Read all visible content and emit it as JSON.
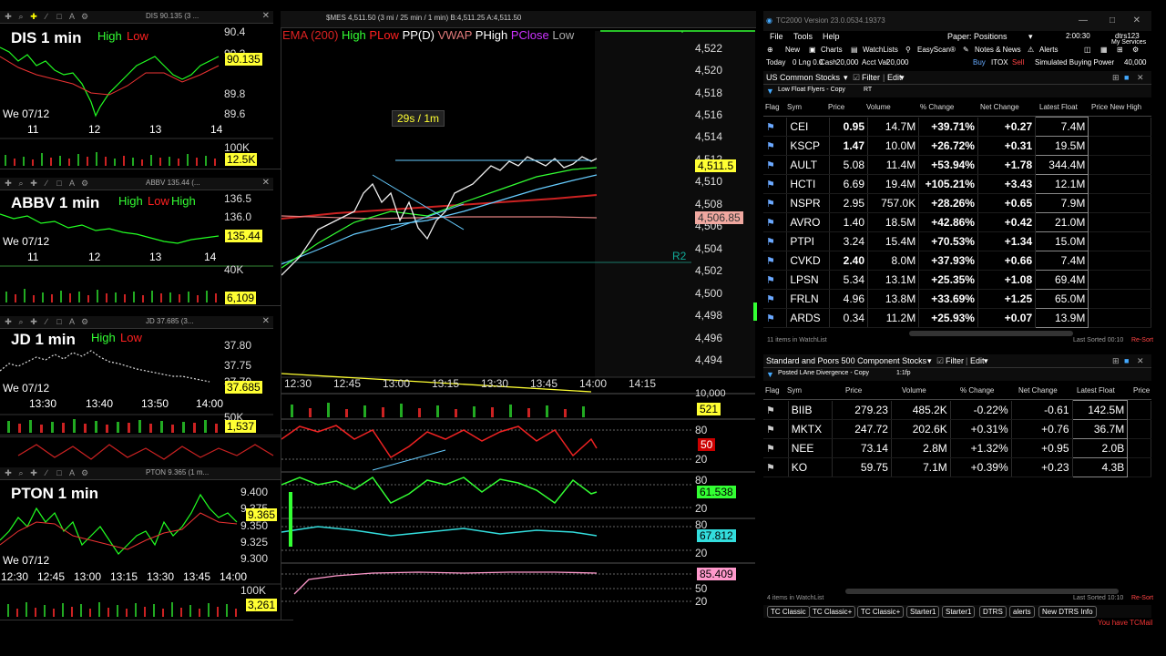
{
  "mini_charts": [
    {
      "caption": "DIS 90.135 (3 ...",
      "title": "DIS 1 min",
      "legend": [
        "High",
        "Low"
      ],
      "date": "We 07/12",
      "y_ticks": [
        "90.4",
        "90.2",
        "89.8",
        "89.6"
      ],
      "x_ticks": [
        "11",
        "12",
        "13",
        "14"
      ],
      "price_tag": "90.135",
      "volume_tick": "100K",
      "volume_tag": "12.5K"
    },
    {
      "caption": "ABBV 135.44 (...",
      "title": "ABBV 1 min",
      "legend": [
        "High",
        "Low",
        "High"
      ],
      "date": "We 07/12",
      "y_ticks": [
        "136.5",
        "136.0",
        "40K"
      ],
      "x_ticks": [
        "11",
        "12",
        "13",
        "14"
      ],
      "price_tag": "135.44",
      "volume_tick": "",
      "volume_tag": "6,109"
    },
    {
      "caption": "JD 37.685 (3...",
      "title": "JD 1 min",
      "legend": [
        "High",
        "Low"
      ],
      "date": "We 07/12",
      "y_ticks": [
        "37.80",
        "37.75",
        "37.70"
      ],
      "x_ticks": [
        "13:30",
        "13:40",
        "13:50",
        "14:00"
      ],
      "price_tag": "37.685",
      "volume_tick": "50K",
      "volume_tag": "1,537"
    },
    {
      "caption": "PTON 9.365 (1 m...",
      "title": "PTON 1 min",
      "legend": [],
      "date": "We 07/12",
      "y_ticks": [
        "9.400",
        "9.375",
        "9.350",
        "9.325",
        "9.300"
      ],
      "x_ticks": [
        "12:30",
        "12:45",
        "13:00",
        "13:15",
        "13:30",
        "13:45",
        "14:00"
      ],
      "price_tag": "9.365",
      "volume_tick": "100K",
      "volume_tag": "3,261"
    }
  ],
  "main_chart": {
    "caption": "$MES 4,511.50 (3 mi / 25 min / 1 min) B:4,511.25 A:4,511.50",
    "legend": [
      {
        "text": "EMA (200)",
        "color": "#d22"
      },
      {
        "text": "High",
        "color": "#33ff33"
      },
      {
        "text": "PLow",
        "color": "#ff2020"
      },
      {
        "text": "PP(D)",
        "color": "#ffffff"
      },
      {
        "text": "VWAP",
        "color": "#e07a7a"
      },
      {
        "text": "PHigh",
        "color": "#ffffff"
      },
      {
        "text": "PClose",
        "color": "#cc33ff"
      },
      {
        "text": "Low",
        "color": "#aaaaaa"
      }
    ],
    "interval_label": "29s / 1m",
    "pivot_label": "R2",
    "y_ticks": [
      "4,522",
      "4,520",
      "4,518",
      "4,516",
      "4,514",
      "4,512",
      "4,510",
      "4,508",
      "4,506",
      "4,504",
      "4,502",
      "4,500",
      "4,498",
      "4,496",
      "4,494"
    ],
    "x_ticks": [
      "12:30",
      "12:45",
      "13:00",
      "13:15",
      "13:30",
      "13:45",
      "14:00",
      "14:15"
    ],
    "price_tag": "4,511.5",
    "vwap_tag": "4,506.85",
    "volume_tick": "10,000",
    "volume_tag": "521",
    "stoch_tag": "50",
    "stoch_ticks": [
      "80",
      "20"
    ],
    "ind2_tag": "61.538",
    "ind2_ticks": [
      "80",
      "20"
    ],
    "ind3_tag": "67.812",
    "ind3_ticks": [
      "80",
      "20"
    ],
    "ind4_tag": "85.409",
    "ind4_ticks": [
      "80",
      "50",
      "20"
    ]
  },
  "right_panel": {
    "window_title": "TC2000 Version 23.0.0534.19373",
    "clock": "2:00:30",
    "user": "dtrs123",
    "user_sub": "My Services",
    "menu": [
      "File",
      "Tools",
      "Help"
    ],
    "layout_name": "Paper: Positions",
    "toolbar": [
      "New",
      "Charts",
      "WatchLists",
      "EasyScan®",
      "Notes & News",
      "Alerts"
    ],
    "account": {
      "today": "Today",
      "lng": "0 Lng 0.0",
      "cash_label": "Cash",
      "cash": "20,000",
      "acct_label": "Acct Val",
      "acct_val": "20,000",
      "buy": "Buy",
      "sym": "ITOX",
      "sell": "Sell",
      "buying_power_label": "Simulated Buying Power",
      "buying_power": "40,000"
    },
    "watchlist1": {
      "name": "US Common Stocks",
      "filter": "Filter",
      "edit": "Edit",
      "sub": "Low Float Flyers - Copy",
      "sub2": "RT",
      "columns": [
        "Flag",
        "Sym",
        "Price",
        "Volume",
        "% Change",
        "Net Change",
        "Latest Float",
        "Price New High"
      ],
      "rows": [
        {
          "sym": "CEI",
          "price": "0.95",
          "volume": "14.7M",
          "pct": "+39.71%",
          "net": "+0.27",
          "float": "7.4M",
          "bold": true
        },
        {
          "sym": "KSCP",
          "price": "1.47",
          "volume": "10.0M",
          "pct": "+26.72%",
          "net": "+0.31",
          "float": "19.5M",
          "bold": true
        },
        {
          "sym": "AULT",
          "price": "5.08",
          "volume": "11.4M",
          "pct": "+53.94%",
          "net": "+1.78",
          "float": "344.4M",
          "bold": false
        },
        {
          "sym": "HCTI",
          "price": "6.69",
          "volume": "19.4M",
          "pct": "+105.21%",
          "net": "+3.43",
          "float": "12.1M",
          "bold": false
        },
        {
          "sym": "NSPR",
          "price": "2.95",
          "volume": "757.0K",
          "pct": "+28.26%",
          "net": "+0.65",
          "float": "7.9M",
          "bold": false
        },
        {
          "sym": "AVRO",
          "price": "1.40",
          "volume": "18.5M",
          "pct": "+42.86%",
          "net": "+0.42",
          "float": "21.0M",
          "bold": false
        },
        {
          "sym": "PTPI",
          "price": "3.24",
          "volume": "15.4M",
          "pct": "+70.53%",
          "net": "+1.34",
          "float": "15.0M",
          "bold": false
        },
        {
          "sym": "CVKD",
          "price": "2.40",
          "volume": "8.0M",
          "pct": "+37.93%",
          "net": "+0.66",
          "float": "7.4M",
          "bold": true
        },
        {
          "sym": "LPSN",
          "price": "5.34",
          "volume": "13.1M",
          "pct": "+25.35%",
          "net": "+1.08",
          "float": "69.4M",
          "bold": false
        },
        {
          "sym": "FRLN",
          "price": "4.96",
          "volume": "13.8M",
          "pct": "+33.69%",
          "net": "+1.25",
          "float": "65.0M",
          "bold": false
        },
        {
          "sym": "ARDS",
          "price": "0.34",
          "volume": "11.2M",
          "pct": "+25.93%",
          "net": "+0.07",
          "float": "13.9M",
          "bold": false
        }
      ],
      "footer_count": "11 items in WatchList",
      "footer_sorted": "Last Sorted 00:10",
      "footer_resort": "Re-Sort"
    },
    "watchlist2": {
      "name": "Standard and Poors 500 Component Stocks",
      "filter": "Filter",
      "edit": "Edit",
      "sub": "Posted LAne Divergence - Copy",
      "sub2": "1:1fp",
      "columns": [
        "Flag",
        "Sym",
        "Price",
        "Volume",
        "% Change",
        "Net Change",
        "Latest Float",
        "Price"
      ],
      "rows": [
        {
          "sym": "BIIB",
          "price": "279.23",
          "volume": "485.2K",
          "pct": "-0.22%",
          "net": "-0.61",
          "float": "142.5M",
          "up": false
        },
        {
          "sym": "MKTX",
          "price": "247.72",
          "volume": "202.6K",
          "pct": "+0.31%",
          "net": "+0.76",
          "float": "36.7M",
          "up": true
        },
        {
          "sym": "NEE",
          "price": "73.14",
          "volume": "2.8M",
          "pct": "+1.32%",
          "net": "+0.95",
          "float": "2.0B",
          "up": true
        },
        {
          "sym": "KO",
          "price": "59.75",
          "volume": "7.1M",
          "pct": "+0.39%",
          "net": "+0.23",
          "float": "4.3B",
          "up": true
        }
      ],
      "footer_count": "4 items in WatchList",
      "footer_sorted": "Last Sorted 10:10",
      "footer_resort": "Re-Sort"
    },
    "tabs": [
      "TC Classic",
      "TC Classic+",
      "TC Classic+",
      "Starter1",
      "Starter1",
      "DTRS",
      "alerts",
      "New DTRS Info"
    ],
    "status": "You have TCMail"
  }
}
